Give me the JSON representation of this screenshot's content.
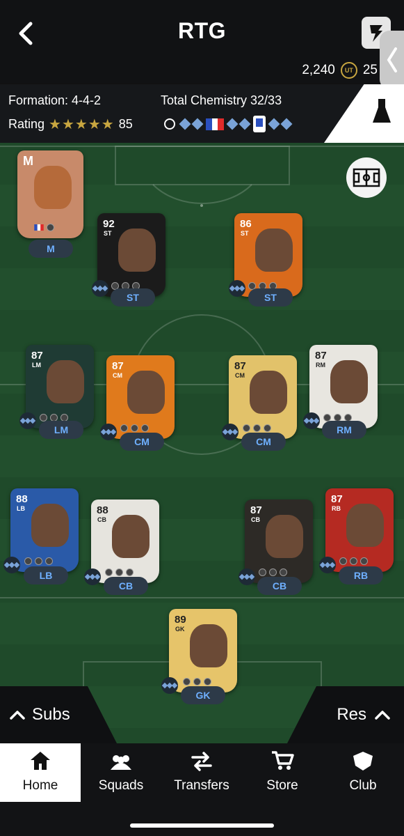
{
  "header": {
    "title": "RTG",
    "coins": "2,240",
    "points": "25"
  },
  "info": {
    "formation": "Formation: 4-4-2",
    "chemistry": "Total Chemistry 32/33",
    "rating_label": "Rating",
    "stars": "★★★★★",
    "rating_value": "85"
  },
  "manager": {
    "letter": "M",
    "label": "M"
  },
  "players": [
    {
      "id": "st-left",
      "rating": "92",
      "pos": "ST",
      "label": "ST",
      "card": "#1b1b1b"
    },
    {
      "id": "st-right",
      "rating": "86",
      "pos": "ST",
      "label": "ST",
      "card": "#d96a1c"
    },
    {
      "id": "lm",
      "rating": "87",
      "pos": "LM",
      "label": "LM",
      "card": "#1f3b34"
    },
    {
      "id": "cm-left",
      "rating": "87",
      "pos": "CM",
      "label": "CM",
      "card": "#e07a1c"
    },
    {
      "id": "cm-right",
      "rating": "87",
      "pos": "CM",
      "label": "CM",
      "card": "#e2c26a"
    },
    {
      "id": "rm",
      "rating": "87",
      "pos": "RM",
      "label": "RM",
      "card": "#e8e6e0"
    },
    {
      "id": "lb",
      "rating": "88",
      "pos": "LB",
      "label": "LB",
      "card": "#2a5aa8"
    },
    {
      "id": "cb-left",
      "rating": "88",
      "pos": "CB",
      "label": "CB",
      "card": "#e6e4de"
    },
    {
      "id": "cb-right",
      "rating": "87",
      "pos": "CB",
      "label": "CB",
      "card": "#2d2a26"
    },
    {
      "id": "rb",
      "rating": "87",
      "pos": "RB",
      "label": "RB",
      "card": "#b52a22"
    },
    {
      "id": "gk",
      "rating": "89",
      "pos": "GK",
      "label": "GK",
      "card": "#e6c46a"
    }
  ],
  "panels": {
    "subs": "Subs",
    "res": "Res"
  },
  "nav": {
    "home": "Home",
    "squads": "Squads",
    "transfers": "Transfers",
    "store": "Store",
    "club": "Club"
  },
  "colors": {
    "accent_gold": "#c8a640",
    "label_blue": "#6fb0ff",
    "pitch": "#1f4a2a"
  }
}
